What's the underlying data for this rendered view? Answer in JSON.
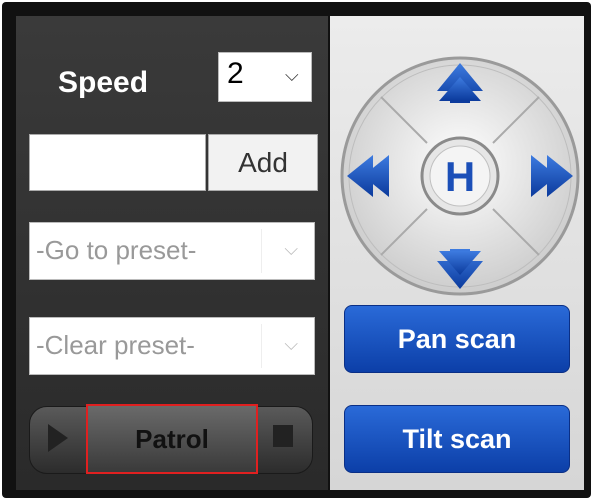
{
  "speed": {
    "label": "Speed",
    "value": "2"
  },
  "preset": {
    "input_value": "",
    "add_label": "Add"
  },
  "goto_preset": {
    "selected": "-Go to preset-"
  },
  "clear_preset": {
    "selected": "-Clear preset-"
  },
  "patrol": {
    "label": "Patrol"
  },
  "scan": {
    "pan_label": "Pan scan",
    "tilt_label": "Tilt scan"
  },
  "dpad": {
    "home_label": "H"
  },
  "colors": {
    "accent_blue": "#1450c4",
    "panel_dark": "#333333",
    "highlight_red": "#e02020"
  }
}
